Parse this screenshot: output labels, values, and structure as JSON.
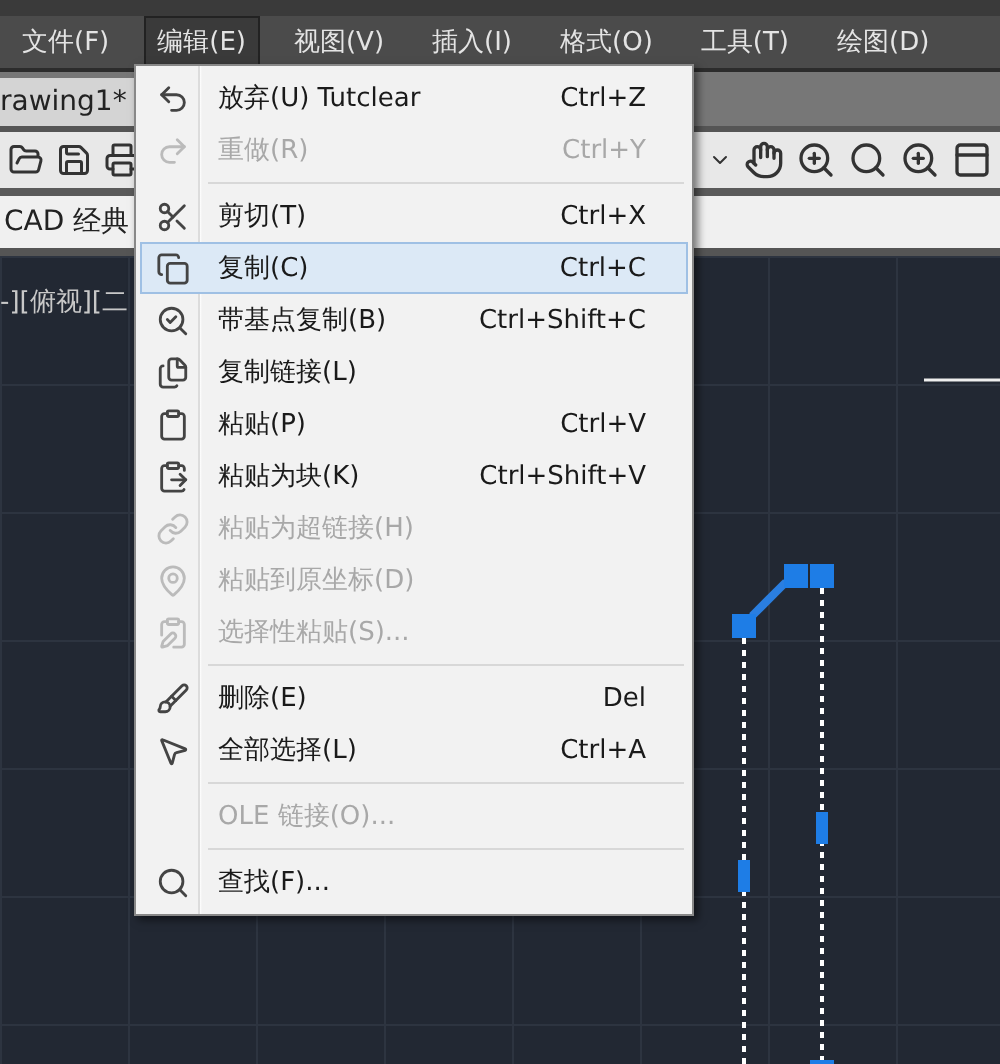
{
  "menubar": [
    {
      "label": "文件(F)",
      "selected": false
    },
    {
      "label": "编辑(E)",
      "selected": true
    },
    {
      "label": "视图(V)",
      "selected": false
    },
    {
      "label": "插入(I)",
      "selected": false
    },
    {
      "label": "格式(O)",
      "selected": false
    },
    {
      "label": "工具(T)",
      "selected": false
    },
    {
      "label": "绘图(D)",
      "selected": false
    }
  ],
  "document_tab": {
    "label": "rawing1*"
  },
  "workspace": {
    "label": "CAD 经典"
  },
  "viewport": {
    "label": "-][俯视][二"
  },
  "edit_menu": [
    {
      "kind": "item",
      "label": "放弃(U) Tutclear",
      "shortcut": "Ctrl+Z",
      "disabled": false,
      "selected": false
    },
    {
      "kind": "item",
      "label": "重做(R)",
      "shortcut": "Ctrl+Y",
      "disabled": true,
      "selected": false
    },
    {
      "kind": "separator"
    },
    {
      "kind": "item",
      "label": "剪切(T)",
      "shortcut": "Ctrl+X",
      "disabled": false,
      "selected": false
    },
    {
      "kind": "item",
      "label": "复制(C)",
      "shortcut": "Ctrl+C",
      "disabled": false,
      "selected": true
    },
    {
      "kind": "item",
      "label": "带基点复制(B)",
      "shortcut": "Ctrl+Shift+C",
      "disabled": false,
      "selected": false
    },
    {
      "kind": "item",
      "label": "复制链接(L)",
      "disabled": false,
      "selected": false
    },
    {
      "kind": "item",
      "label": "粘贴(P)",
      "shortcut": "Ctrl+V",
      "disabled": false,
      "selected": false
    },
    {
      "kind": "item",
      "label": "粘贴为块(K)",
      "shortcut": "Ctrl+Shift+V",
      "disabled": false,
      "selected": false
    },
    {
      "kind": "item",
      "label": "粘贴为超链接(H)",
      "disabled": true,
      "selected": false
    },
    {
      "kind": "item",
      "label": "粘贴到原坐标(D)",
      "disabled": true,
      "selected": false
    },
    {
      "kind": "item",
      "label": "选择性粘贴(S)...",
      "disabled": true,
      "selected": false
    },
    {
      "kind": "separator"
    },
    {
      "kind": "item",
      "label": "删除(E)",
      "shortcut": "Del",
      "disabled": false,
      "selected": false
    },
    {
      "kind": "item",
      "label": "全部选择(L)",
      "shortcut": "Ctrl+A",
      "disabled": false,
      "selected": false
    },
    {
      "kind": "separator"
    },
    {
      "kind": "item",
      "label": "OLE 链接(O)...",
      "disabled": true,
      "selected": false
    },
    {
      "kind": "separator"
    },
    {
      "kind": "item",
      "label": "查找(F)...",
      "disabled": false,
      "selected": false
    }
  ]
}
